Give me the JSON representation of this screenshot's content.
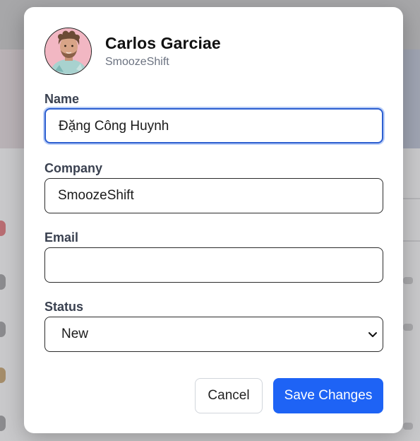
{
  "contact": {
    "name": "Carlos Garciae",
    "company": "SmoozeShift"
  },
  "form": {
    "name_label": "Name",
    "name_value": "Đặng Công Huynh",
    "company_label": "Company",
    "company_value": "SmoozeShift",
    "email_label": "Email",
    "email_value": "",
    "status_label": "Status",
    "status_value": "New"
  },
  "actions": {
    "cancel_label": "Cancel",
    "save_label": "Save Changes"
  },
  "colors": {
    "primary": "#1e63f5",
    "focus_ring": "#3b76ea",
    "label": "#3a4150",
    "muted": "#6b7280"
  },
  "icons": {
    "avatar": "user-avatar-photo",
    "select": "chevron-down-icon"
  }
}
